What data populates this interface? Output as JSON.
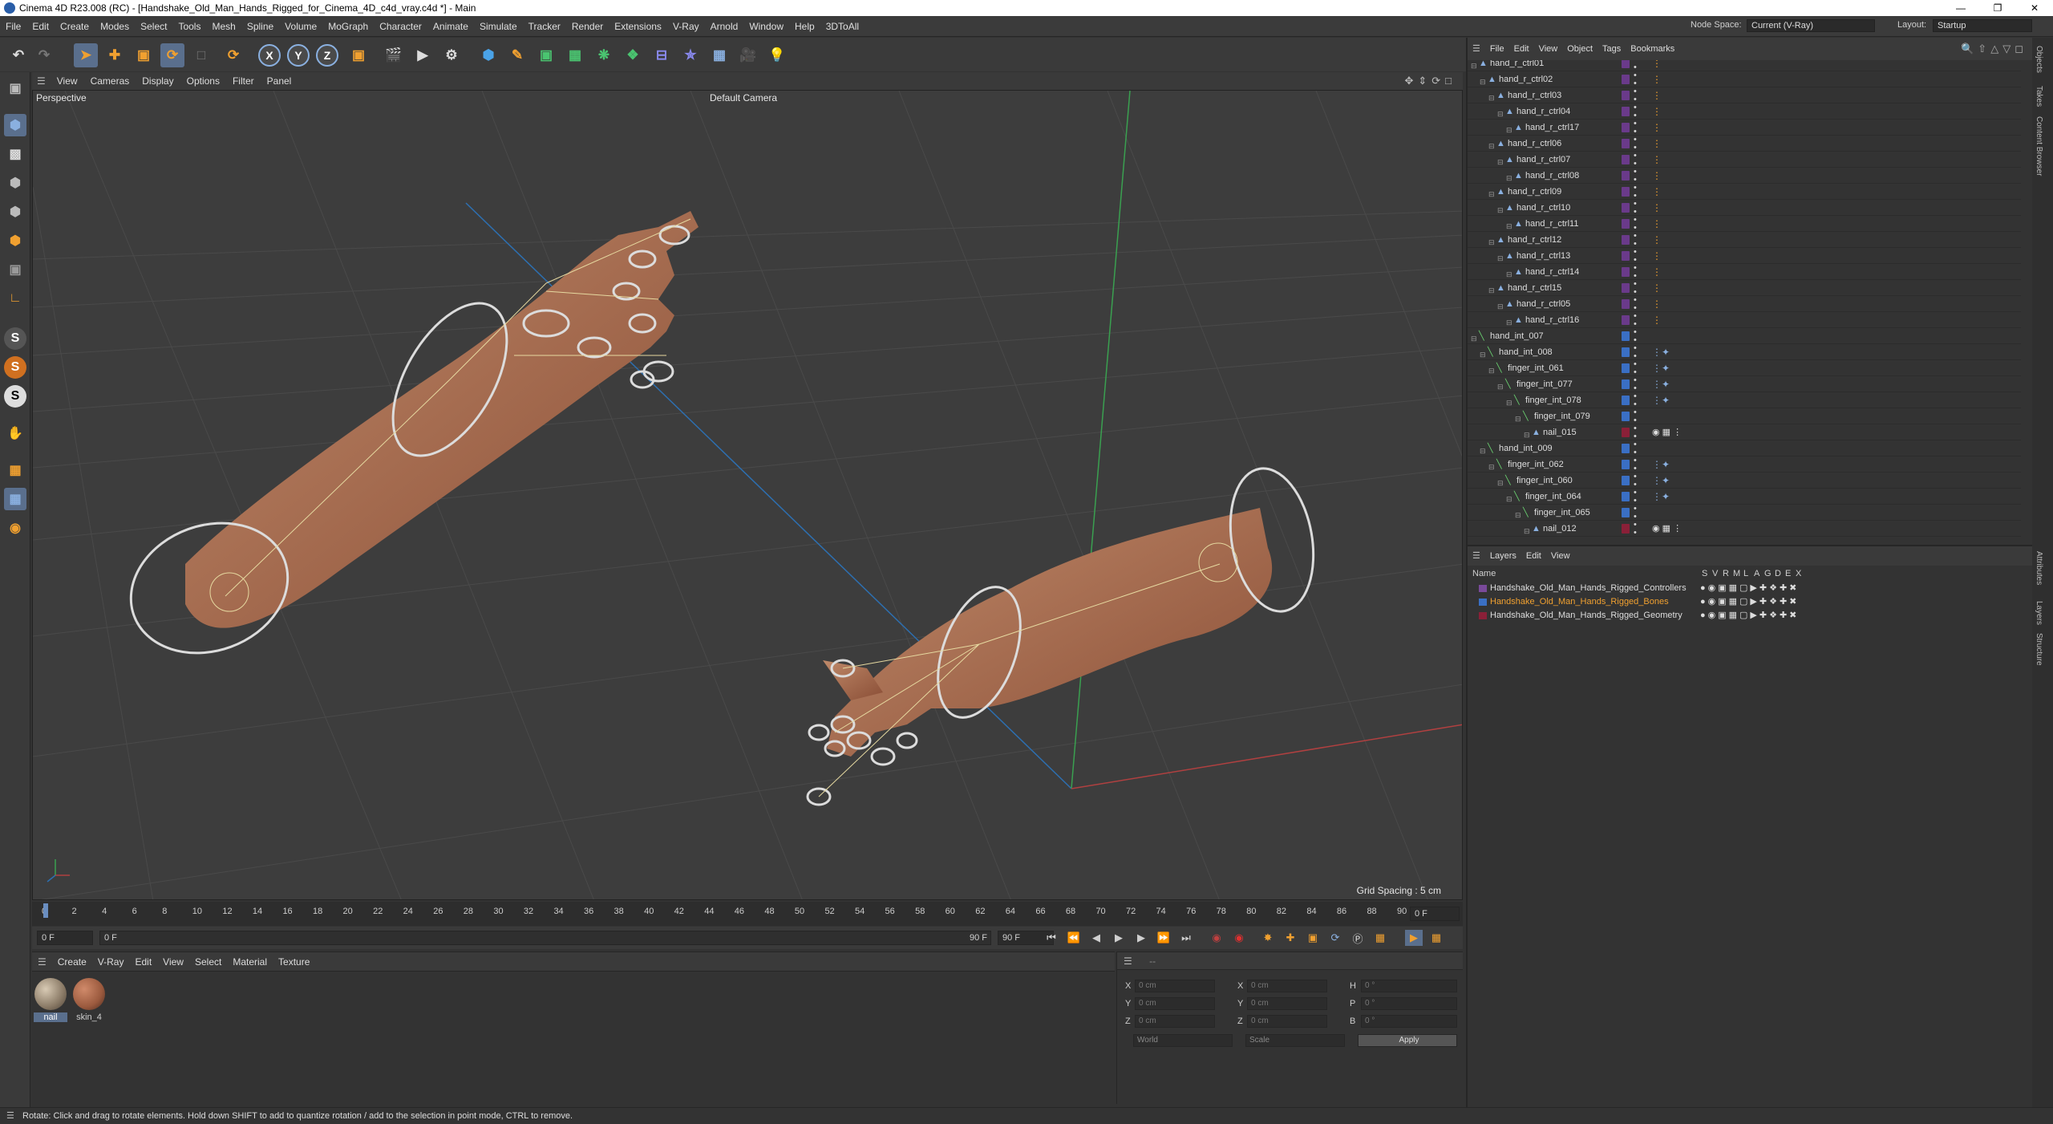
{
  "window": {
    "title": "Cinema 4D R23.008 (RC) - [Handshake_Old_Man_Hands_Rigged_for_Cinema_4D_c4d_vray.c4d *] - Main"
  },
  "menu": [
    "File",
    "Edit",
    "Create",
    "Modes",
    "Select",
    "Tools",
    "Mesh",
    "Spline",
    "Volume",
    "MoGraph",
    "Character",
    "Animate",
    "Simulate",
    "Tracker",
    "Render",
    "Extensions",
    "V-Ray",
    "Arnold",
    "Window",
    "Help",
    "3DToAll"
  ],
  "node_space": {
    "label": "Node Space:",
    "value": "Current (V-Ray)"
  },
  "layout": {
    "label": "Layout:",
    "value": "Startup"
  },
  "toolbar_axes": [
    "X",
    "Y",
    "Z"
  ],
  "viewport": {
    "menu": [
      "View",
      "Cameras",
      "Display",
      "Options",
      "Filter",
      "Panel"
    ],
    "view_name": "Perspective",
    "camera": "Default Camera",
    "grid_spacing": "Grid Spacing : 5 cm"
  },
  "timeline": {
    "ticks": [
      "0",
      "2",
      "4",
      "6",
      "8",
      "10",
      "12",
      "14",
      "16",
      "18",
      "20",
      "22",
      "24",
      "26",
      "28",
      "30",
      "32",
      "34",
      "36",
      "38",
      "40",
      "42",
      "44",
      "46",
      "48",
      "50",
      "52",
      "54",
      "56",
      "58",
      "60",
      "62",
      "64",
      "66",
      "68",
      "70",
      "72",
      "74",
      "76",
      "78",
      "80",
      "82",
      "84",
      "86",
      "88",
      "90"
    ],
    "frame_field": "0 F",
    "current_frame": "0 F",
    "start_frame": "0 F",
    "end_range": "90 F",
    "end_frame": "90 F"
  },
  "material_panel": {
    "menu": [
      "Create",
      "V-Ray",
      "Edit",
      "View",
      "Select",
      "Material",
      "Texture"
    ],
    "materials": [
      {
        "name": "nail",
        "color": "#8a7a66"
      },
      {
        "name": "skin_4",
        "color": "#9b5a3e"
      }
    ]
  },
  "attributes": {
    "header": "--",
    "pos_labels": [
      "X",
      "Y",
      "Z"
    ],
    "size_labels": [
      "X",
      "Y",
      "Z"
    ],
    "rot_labels": [
      "H",
      "P",
      "B"
    ],
    "pos_values": [
      "0 cm",
      "0 cm",
      "0 cm"
    ],
    "size_values": [
      "0 cm",
      "0 cm",
      "0 cm"
    ],
    "rot_values": [
      "0 °",
      "0 °",
      "0 °"
    ],
    "coord_mode": "World",
    "size_mode": "Scale",
    "apply_label": "Apply"
  },
  "object_manager": {
    "menu": [
      "File",
      "Edit",
      "View",
      "Object",
      "Tags",
      "Bookmarks"
    ],
    "rows": [
      {
        "name": "hand_r_ctrl01",
        "color": "#6a3a8a",
        "tag": "ctrl"
      },
      {
        "name": "hand_r_ctrl02",
        "color": "#6a3a8a",
        "tag": "ctrl"
      },
      {
        "name": "hand_r_ctrl03",
        "color": "#6a3a8a",
        "tag": "ctrl"
      },
      {
        "name": "hand_r_ctrl04",
        "color": "#6a3a8a",
        "tag": "ctrl"
      },
      {
        "name": "hand_r_ctrl17",
        "color": "#6a3a8a",
        "tag": "ctrl"
      },
      {
        "name": "hand_r_ctrl06",
        "color": "#6a3a8a",
        "tag": "ctrl"
      },
      {
        "name": "hand_r_ctrl07",
        "color": "#6a3a8a",
        "tag": "ctrl"
      },
      {
        "name": "hand_r_ctrl08",
        "color": "#6a3a8a",
        "tag": "ctrl"
      },
      {
        "name": "hand_r_ctrl09",
        "color": "#6a3a8a",
        "tag": "ctrl"
      },
      {
        "name": "hand_r_ctrl10",
        "color": "#6a3a8a",
        "tag": "ctrl"
      },
      {
        "name": "hand_r_ctrl11",
        "color": "#6a3a8a",
        "tag": "ctrl"
      },
      {
        "name": "hand_r_ctrl12",
        "color": "#6a3a8a",
        "tag": "ctrl"
      },
      {
        "name": "hand_r_ctrl13",
        "color": "#6a3a8a",
        "tag": "ctrl"
      },
      {
        "name": "hand_r_ctrl14",
        "color": "#6a3a8a",
        "tag": "ctrl"
      },
      {
        "name": "hand_r_ctrl15",
        "color": "#6a3a8a",
        "tag": "ctrl"
      },
      {
        "name": "hand_r_ctrl05",
        "color": "#6a3a8a",
        "tag": "ctrl"
      },
      {
        "name": "hand_r_ctrl16",
        "color": "#6a3a8a",
        "tag": "ctrl"
      },
      {
        "name": "hand_int_007",
        "color": "#3a6fc4",
        "tag": ""
      },
      {
        "name": "hand_int_008",
        "color": "#3a6fc4",
        "tag": "ik"
      },
      {
        "name": "finger_int_061",
        "color": "#3a6fc4",
        "tag": "ik"
      },
      {
        "name": "finger_int_077",
        "color": "#3a6fc4",
        "tag": "ik"
      },
      {
        "name": "finger_int_078",
        "color": "#3a6fc4",
        "tag": "ik"
      },
      {
        "name": "finger_int_079",
        "color": "#3a6fc4",
        "tag": ""
      },
      {
        "name": "nail_015",
        "color": "#8a2038",
        "tag": "mat"
      },
      {
        "name": "hand_int_009",
        "color": "#3a6fc4",
        "tag": ""
      },
      {
        "name": "finger_int_062",
        "color": "#3a6fc4",
        "tag": "ik"
      },
      {
        "name": "finger_int_060",
        "color": "#3a6fc4",
        "tag": "ik"
      },
      {
        "name": "finger_int_064",
        "color": "#3a6fc4",
        "tag": "ik"
      },
      {
        "name": "finger_int_065",
        "color": "#3a6fc4",
        "tag": ""
      },
      {
        "name": "nail_012",
        "color": "#8a2038",
        "tag": "mat"
      }
    ]
  },
  "layer_manager": {
    "menu": [
      "Layers",
      "Edit",
      "View"
    ],
    "name_header": "Name",
    "flag_headers": [
      "S",
      "V",
      "R",
      "M",
      "L",
      "A",
      "G",
      "D",
      "E",
      "X"
    ],
    "layers": [
      {
        "name": "Handshake_Old_Man_Hands_Rigged_Controllers",
        "color": "#7a4a9a",
        "text_color": "#dddddd"
      },
      {
        "name": "Handshake_Old_Man_Hands_Rigged_Bones",
        "color": "#3a6fc4",
        "text_color": "#f0a030"
      },
      {
        "name": "Handshake_Old_Man_Hands_Rigged_Geometry",
        "color": "#8a2038",
        "text_color": "#dddddd"
      }
    ]
  },
  "side_tabs": [
    "Objects",
    "Takes",
    "Content Browser",
    "Attributes",
    "Layers",
    "Structure"
  ],
  "status": "Rotate: Click and drag to rotate elements. Hold down SHIFT to add to quantize rotation / add to the selection in point mode, CTRL to remove."
}
